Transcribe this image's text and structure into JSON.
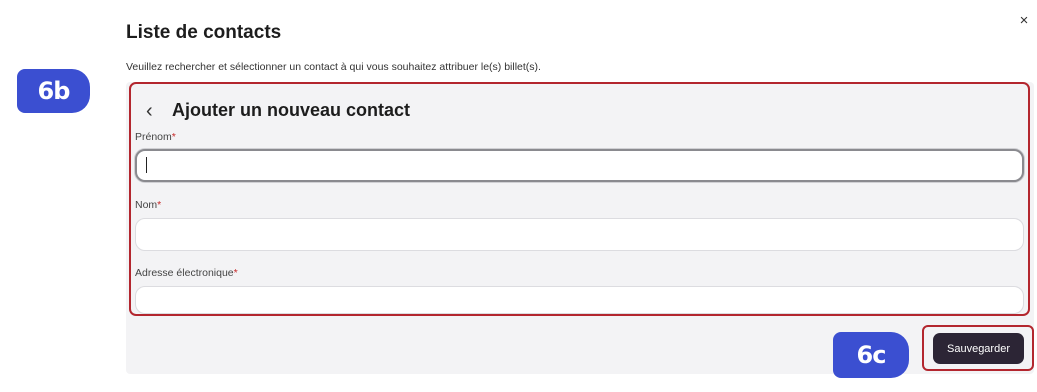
{
  "modal": {
    "title": "Liste de contacts",
    "close_label": "×",
    "subtitle": "Veuillez rechercher et sélectionner un contact à qui vous souhaitez attribuer le(s) billet(s)."
  },
  "annotations": {
    "badge_form": "6b",
    "badge_save": "6c",
    "badge_color": "#3b4fd1",
    "highlight_color": "#b3262e"
  },
  "form": {
    "back_icon": "chevron-left-icon",
    "back_glyph": "‹",
    "heading": "Ajouter un nouveau contact",
    "fields": [
      {
        "label": "Prénom",
        "required_mark": "*",
        "value": "",
        "placeholder": "",
        "focused": true
      },
      {
        "label": "Nom",
        "required_mark": "*",
        "value": "",
        "placeholder": ""
      },
      {
        "label": "Adresse électronique",
        "required_mark": "*",
        "value": "",
        "placeholder": ""
      }
    ]
  },
  "actions": {
    "save_label": "Sauvegarder",
    "save_color": "#2c2535"
  }
}
